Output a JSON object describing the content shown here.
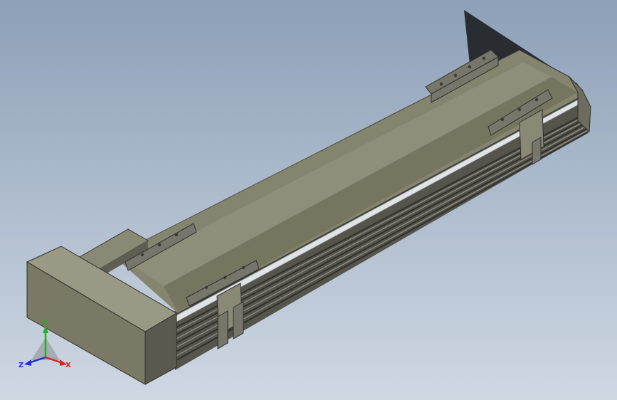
{
  "viewport": {
    "background_top": "#8da0b8",
    "background_bottom": "#cfd8e3"
  },
  "model": {
    "body_color": "#8c8b78",
    "top_color": "#7a7968",
    "side_color": "#5f5e51",
    "dark_color": "#2f2f2d",
    "rail_color": "#d9dde0",
    "shadow_color": "#1f2326"
  },
  "triad": {
    "x_label": "X",
    "y_label": "Y",
    "z_label": "Z",
    "x_color": "#e02020",
    "y_color": "#20b020",
    "z_color": "#2030d0"
  }
}
